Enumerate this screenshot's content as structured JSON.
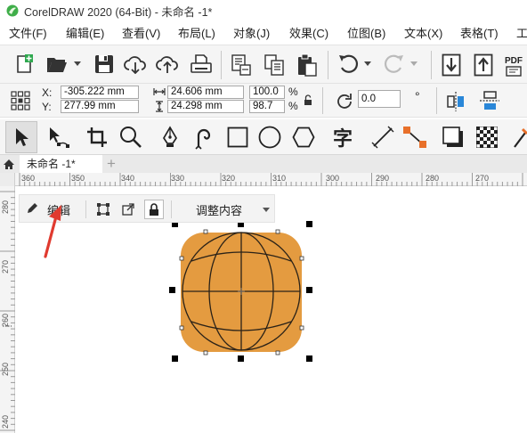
{
  "window": {
    "title": "CorelDRAW 2020 (64-Bit) - 未命名 -1*"
  },
  "menu": [
    "文件(F)",
    "编辑(E)",
    "查看(V)",
    "布局(L)",
    "对象(J)",
    "效果(C)",
    "位图(B)",
    "文本(X)",
    "表格(T)",
    "工"
  ],
  "toolbar": {
    "pdf_label": "PDF"
  },
  "property_bar": {
    "x_label": "X:",
    "y_label": "Y:",
    "x_value": "-305.222 mm",
    "y_value": "277.99 mm",
    "width_value": "24.606 mm",
    "height_value": "24.298 mm",
    "scale_x": "100.0",
    "scale_y": "98.7",
    "percent": "%",
    "rotation_value": "0.0",
    "degree": "°"
  },
  "tools": {
    "text_tool_glyph": "字"
  },
  "tabs": {
    "document_tab": "未命名 -1*",
    "add_tab": "+"
  },
  "ruler": {
    "h_ticks": [
      "360",
      "350",
      "340",
      "330",
      "320",
      "310",
      "300",
      "290",
      "280",
      "270"
    ],
    "v_ticks": [
      "280",
      "270",
      "260",
      "250",
      "240"
    ]
  },
  "context_bar": {
    "edit_label": "编辑",
    "adjust_content_label": "调整内容"
  },
  "colors": {
    "shape_fill": "#E49B40",
    "accent_green": "#2FA84F",
    "arrow_red": "#E03A2F",
    "node_blue": "#2A87D8",
    "node_orange": "#E8702A"
  }
}
